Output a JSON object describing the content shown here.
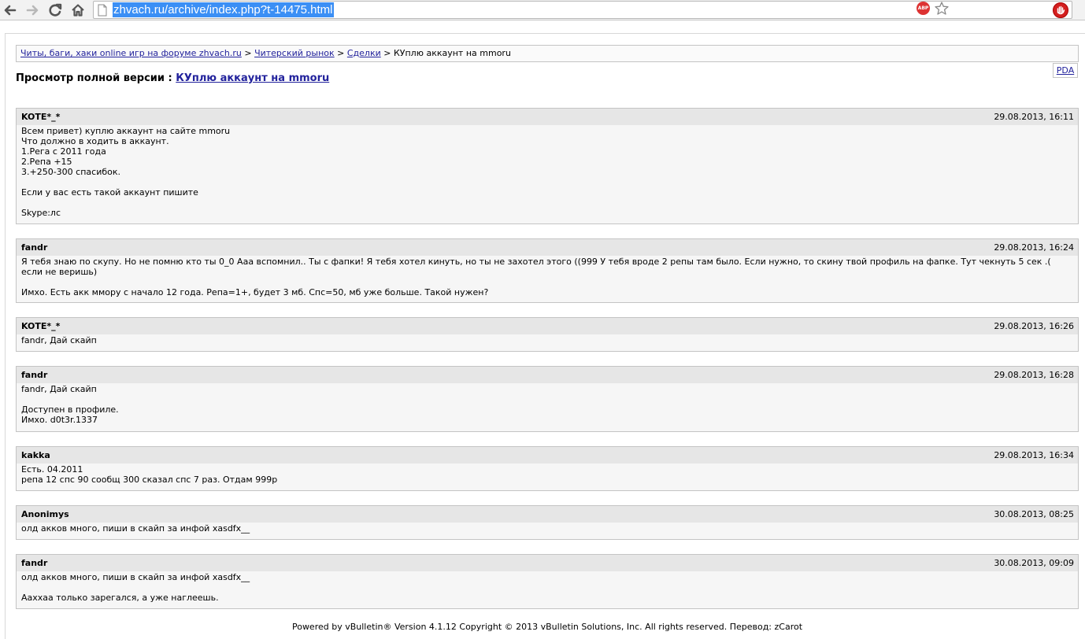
{
  "browser": {
    "url": "zhvach.ru/archive/index.php?t-14475.html",
    "extension_abp_label": "ABP"
  },
  "navbar": {
    "crumbs": [
      "Читы, баги, хаки online игр на форуме zhvach.ru",
      "Читерский рынок",
      "Сделки"
    ],
    "separator": ">",
    "current": "КУплю аккаунт на mmoru"
  },
  "pda_link": "PDA",
  "title": {
    "prefix": "Просмотр полной версии : ",
    "thread": "КУплю аккаунт на mmoru"
  },
  "posts": [
    {
      "user": "KOTE*_*",
      "date": "29.08.2013, 16:11",
      "body": "Всем привет) куплю аккаунт на сайте mmoru\nЧто должно в ходить в аккаунт.\n1.Рега с 2011 года\n2.Репа +15\n3.+250-300 спасибок.\n\nЕсли у вас есть такой аккаунт пишите\n\nSkype:лс"
    },
    {
      "user": "fandr",
      "date": "29.08.2013, 16:24",
      "body": "Я тебя знаю по скупу. Но не помню кто ты 0_0 Ааа вспомнил.. Ты с фапки! Я тебя хотел кинуть, но ты не захотел этого ((999 У тебя вроде 2 репы там было. Если нужно, то скину твой профиль на фапке. Тут чекнуть 5 сек .(\nесли не веришь)\n\nИмхо. Есть акк ммору с начало 12 года. Репа=1+, будет 3 мб. Спс=50, мб уже больше. Такой нужен?"
    },
    {
      "user": "KOTE*_*",
      "date": "29.08.2013, 16:26",
      "body": "fandr, Дай скайп"
    },
    {
      "user": "fandr",
      "date": "29.08.2013, 16:28",
      "body": "fandr, Дай скайп\n\nДоступен в профиле.\nИмхо. d0t3r.1337"
    },
    {
      "user": "kakka",
      "date": "29.08.2013, 16:34",
      "body": "Есть. 04.2011\nрепа 12 спс 90 сообщ 300 сказал спс 7 раз. Отдам 999р"
    },
    {
      "user": "Anonimys",
      "date": "30.08.2013, 08:25",
      "body": "олд акков много, пиши в скайп за инфой xasdfx__"
    },
    {
      "user": "fandr",
      "date": "30.08.2013, 09:09",
      "body": "олд акков много, пиши в скайп за инфой xasdfx__\n\nАаххаа только зарегался, а уже наглеешь."
    }
  ],
  "footer": "Powered by vBulletin® Version 4.1.12 Copyright © 2013 vBulletin Solutions, Inc. All rights reserved. Перевод: zCarot"
}
